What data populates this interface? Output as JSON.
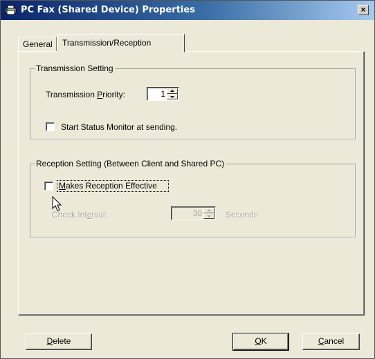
{
  "window": {
    "title": "PC Fax (Shared Device) Properties",
    "close_label": "×"
  },
  "tabs": [
    {
      "label": "General",
      "active": false
    },
    {
      "label": "Transmission/Reception",
      "active": true
    }
  ],
  "transmission": {
    "group_label": "Transmission Setting",
    "priority_label_pre": "Transmission ",
    "priority_label_accel": "P",
    "priority_label_post": "riority:",
    "priority_value": "1",
    "status_monitor_label": "Start Status Monitor at sending.",
    "status_monitor_checked": false
  },
  "reception": {
    "group_label": "Reception Setting (Between Client and Shared PC)",
    "effective_label_accel": "M",
    "effective_label_post": "akes Reception Effective",
    "effective_checked": false,
    "interval_label_pre": "Check Int",
    "interval_label_accel": "e",
    "interval_label_post": "rval:",
    "interval_value": "30",
    "interval_unit": "Seconds"
  },
  "buttons": {
    "delete_accel": "D",
    "delete_rest": "elete",
    "ok_accel": "O",
    "ok_rest": "K",
    "cancel_accel": "C",
    "cancel_rest": "ancel"
  },
  "colors": {
    "titlebar_start": "#0a246a",
    "titlebar_end": "#a6caf0",
    "face": "#ece9d8",
    "disabled_text": "#a9a699"
  }
}
